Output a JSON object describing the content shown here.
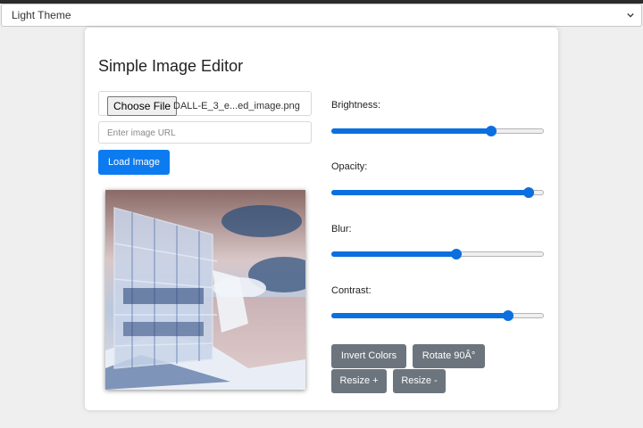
{
  "theme_select": {
    "selected": "Light Theme"
  },
  "editor": {
    "title": "Simple Image Editor",
    "file_input": {
      "button_label": "Choose File",
      "file_name": "DALL-E_3_e...ed_image.png"
    },
    "url_input": {
      "placeholder": "Enter image URL",
      "value": ""
    },
    "load_button": "Load Image",
    "preview_image": "modern glass building by the sea (color-inverted)",
    "controls": [
      {
        "label": "Brightness:",
        "value": 0.75
      },
      {
        "label": "Opacity:",
        "value": 0.93
      },
      {
        "label": "Blur:",
        "value": 0.59
      },
      {
        "label": "Contrast:",
        "value": 0.83
      }
    ],
    "buttons": {
      "invert": "Invert Colors",
      "rotate": "Rotate 90Â°",
      "resize_plus": "Resize +",
      "resize_minus": "Resize -"
    }
  },
  "colors": {
    "primary": "#0d7bf0",
    "secondary": "#6c757d",
    "slider": "#0b6fe0"
  }
}
